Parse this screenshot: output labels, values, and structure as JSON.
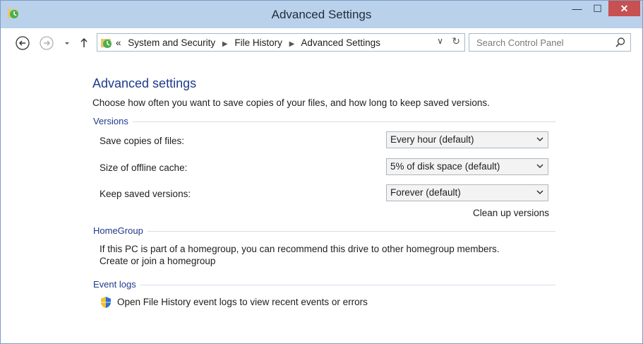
{
  "window": {
    "title": "Advanced Settings",
    "controls": {
      "minimize": "—",
      "maximize": "☐",
      "close": "✕"
    }
  },
  "nav": {
    "back_icon": "back-arrow-icon",
    "forward_icon": "forward-arrow-icon",
    "breadcrumb_prefix": "«",
    "breadcrumbs": [
      "System and Security",
      "File History",
      "Advanced Settings"
    ],
    "search_placeholder": "Search Control Panel"
  },
  "main": {
    "heading": "Advanced settings",
    "intro": "Choose how often you want to save copies of your files, and how long to keep saved versions.",
    "versions": {
      "label": "Versions",
      "rows": [
        {
          "label": "Save copies of files:",
          "value": "Every hour (default)"
        },
        {
          "label": "Size of offline cache:",
          "value": "5% of disk space (default)"
        },
        {
          "label": "Keep saved versions:",
          "value": "Forever (default)"
        }
      ],
      "cleanup_link": "Clean up versions"
    },
    "homegroup": {
      "label": "HomeGroup",
      "text": "If this PC is part of a homegroup, you can recommend this drive to other homegroup members.",
      "link": "Create or join a homegroup"
    },
    "event_logs": {
      "label": "Event logs",
      "link": "Open File History event logs to view recent events or errors"
    }
  },
  "colors": {
    "titlebar": "#b9d1ea",
    "close_button": "#c75050",
    "heading": "#1e3a8c",
    "link": "#1763c7"
  }
}
